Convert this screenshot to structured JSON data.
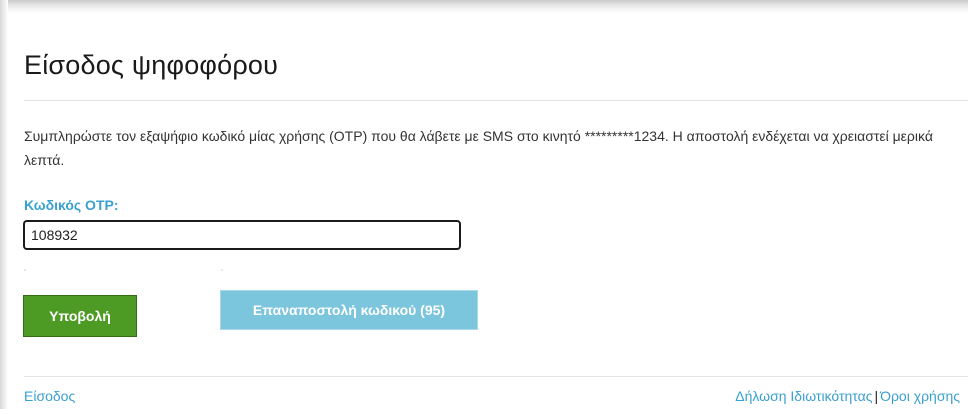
{
  "page": {
    "title": "Είσοδος ψηφοφόρου",
    "instructions": "Συμπληρώστε τον εξαψήφιο κωδικό μίας χρήσης (OTP) που θα λάβετε με SMS στο κινητό *********1234. Η αποστολή ενδέχεται να χρειαστεί μερικά λεπτά."
  },
  "form": {
    "otp_label": "Κωδικός OTP:",
    "otp_value": "108932",
    "submit_label": "Υποβολή",
    "resend_label": "Επαναποστολή κωδικού (95)"
  },
  "footer": {
    "login_link": "Είσοδος",
    "privacy_link": "Δήλωση Ιδιωτικότητας",
    "separator": "|",
    "terms_link": "Όροι χρήσης"
  },
  "colors": {
    "submit_button": "#4d9a24",
    "resend_button": "#7bc5dd",
    "link": "#3aa0d0"
  }
}
